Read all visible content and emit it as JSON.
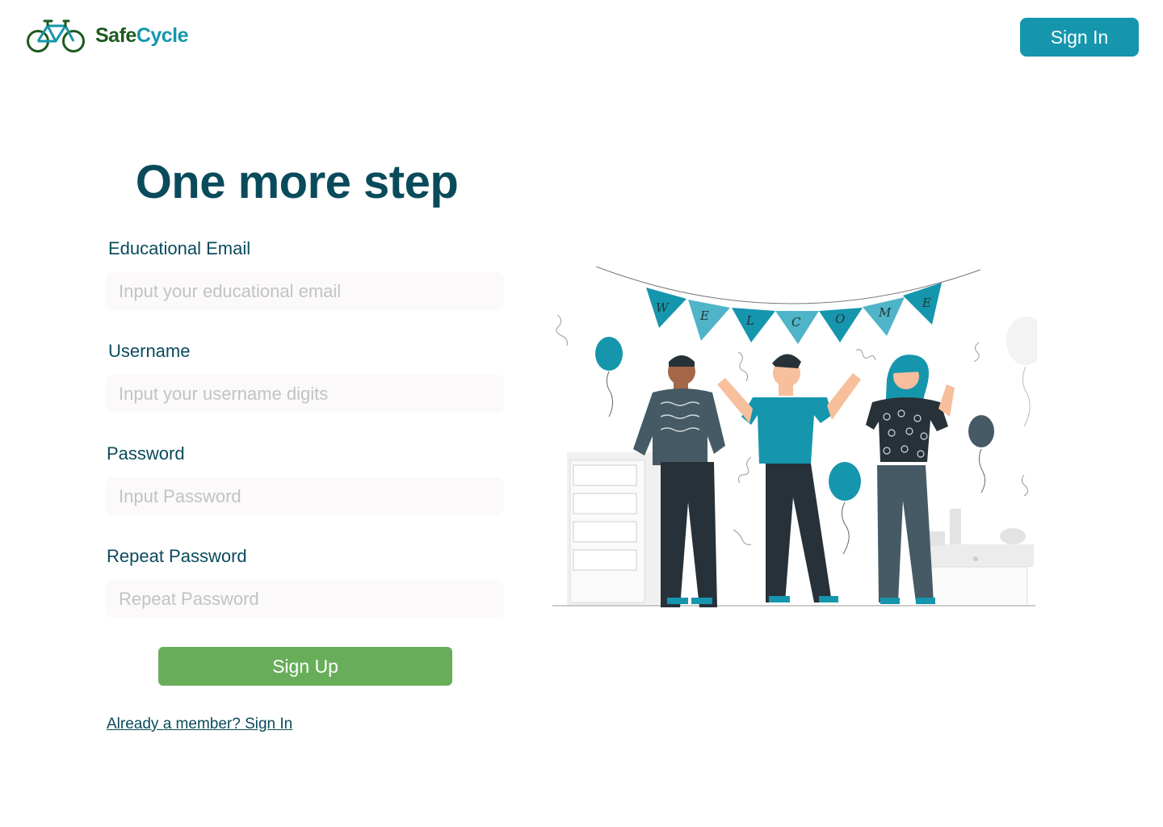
{
  "brand": {
    "name_part1": "Safe",
    "name_part2": "Cycle",
    "logo_icon": "bicycle-icon",
    "colors": {
      "dark_green": "#1d5a1e",
      "teal": "#1596ad"
    }
  },
  "header": {
    "signin_label": "Sign In"
  },
  "form": {
    "title": "One more step",
    "fields": [
      {
        "label": "Educational Email",
        "placeholder": "Input your educational email"
      },
      {
        "label": "Username",
        "placeholder": "Input your username digits"
      },
      {
        "label": "Password",
        "placeholder": "Input Password"
      },
      {
        "label": "Repeat Password",
        "placeholder": "Repeat Password"
      }
    ],
    "submit_label": "Sign Up",
    "member_link": "Already a member? Sign In"
  },
  "illustration": {
    "banner_letters": [
      "W",
      "E",
      "L",
      "C",
      "O",
      "M",
      "E"
    ],
    "colors": {
      "teal": "#1596ad",
      "light_teal": "#4fb4c8",
      "navy": "#27313a",
      "slate": "#455a64",
      "skin_light": "#f7bf9c",
      "skin_dark": "#a46747"
    }
  },
  "colors": {
    "title": "#0a4b5b",
    "signup_green": "#68ae5a",
    "input_bg": "#fbf9fa"
  }
}
